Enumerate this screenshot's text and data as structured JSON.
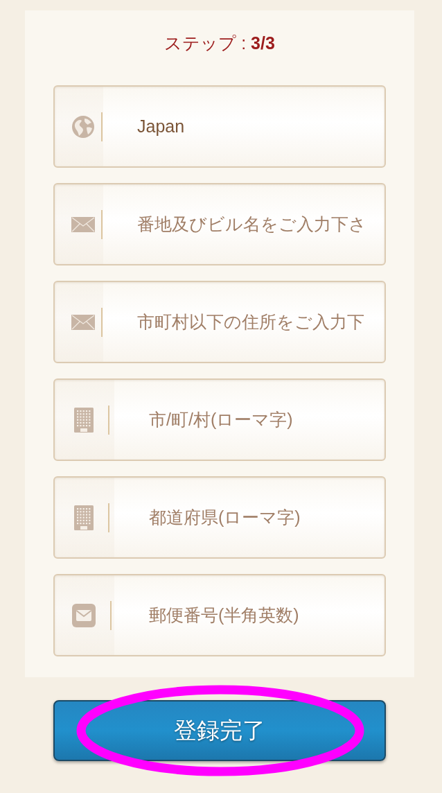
{
  "step_title": "ステップ : **3/3**",
  "fields": [
    {
      "kind": "globe",
      "value": "Japan"
    },
    {
      "kind": "envelope",
      "placeholder": "番地及びビル名をご入力下さ"
    },
    {
      "kind": "envelope",
      "placeholder": "市町村以下の住所をご入力下"
    },
    {
      "kind": "building",
      "placeholder": "市/町/村(ローマ字)"
    },
    {
      "kind": "building",
      "placeholder": "都道府県(ローマ字)"
    },
    {
      "kind": "mail",
      "placeholder": "郵便番号(半角英数)"
    }
  ],
  "submit_button": {
    "label": "登録完了",
    "circled": true
  }
}
